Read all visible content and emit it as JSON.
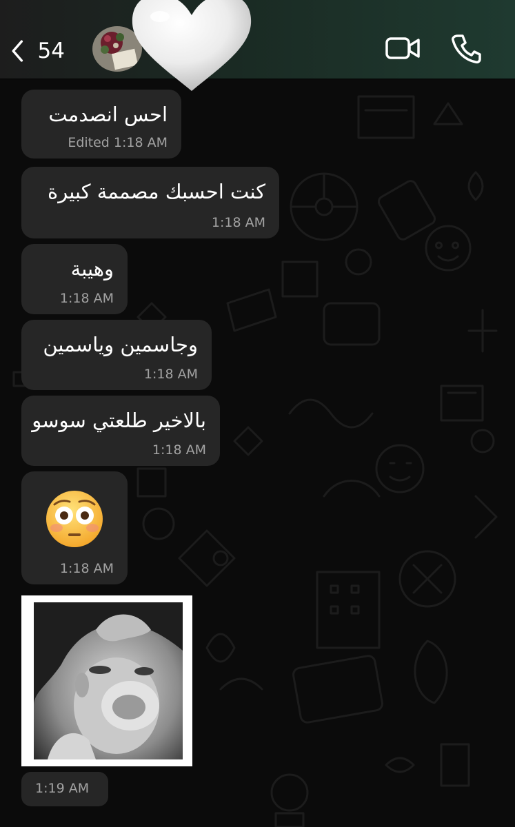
{
  "header": {
    "back_count": "54",
    "colors": {
      "accent_gradient_end": "#1f3a30"
    },
    "icons": {
      "back": "chevron-left-icon",
      "video": "video-camera-icon",
      "phone": "phone-icon",
      "overlay": "white-heart-sticker"
    }
  },
  "messages": [
    {
      "text": "احس انصدمت",
      "meta": "Edited 1:18 AM"
    },
    {
      "text": "كنت احسبك مصممة كبيرة",
      "meta": "1:18 AM"
    },
    {
      "text": "وهيبة",
      "meta": "1:18 AM"
    },
    {
      "text": "وجاسمين وياسمين",
      "meta": "1:18 AM"
    },
    {
      "text": "بالاخير طلعتي سوسو",
      "meta": "1:18 AM"
    },
    {
      "emoji": "flushed-face-emoji",
      "meta": "1:18 AM"
    },
    {
      "image": "monkey-photo",
      "meta": "1:19 AM"
    }
  ],
  "bubble_color": "#262626"
}
